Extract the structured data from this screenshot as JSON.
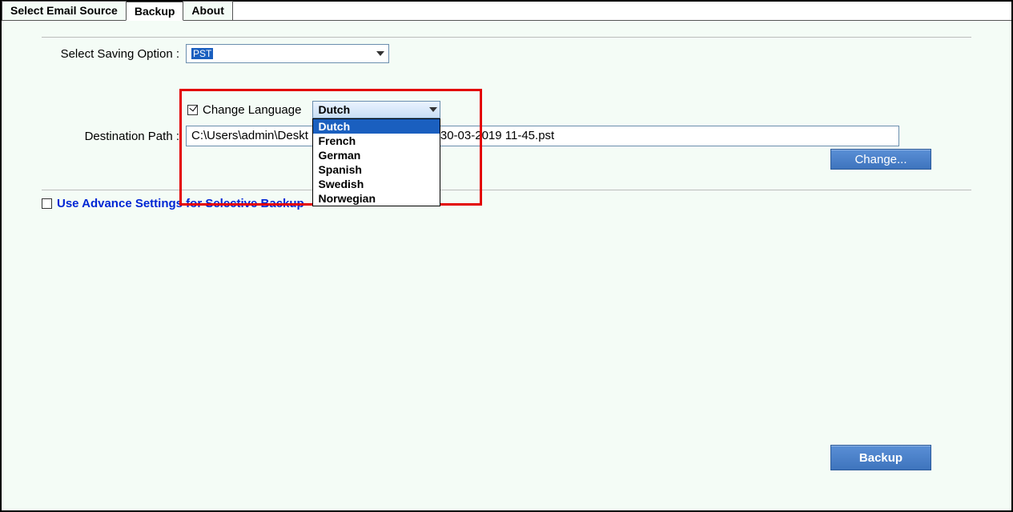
{
  "tabs": {
    "select_email_source": "Select Email Source",
    "backup": "Backup",
    "about": "About"
  },
  "saving_option": {
    "label": "Select Saving Option  :",
    "value": "PST"
  },
  "change_language": {
    "checkbox_label": "Change Language",
    "checked": true,
    "selected": "Dutch",
    "options": [
      "Dutch",
      "French",
      "German",
      "Spanish",
      "Swedish",
      "Norwegian"
    ]
  },
  "destination": {
    "label": "Destination Path  :",
    "value_visible_left": "C:\\Users\\admin\\Deskt",
    "value_visible_right": "30-03-2019 11-45.pst",
    "change_button": "Change..."
  },
  "advance_settings": {
    "label": "Use Advance Settings for Selective Backup"
  },
  "backup_button": "Backup"
}
